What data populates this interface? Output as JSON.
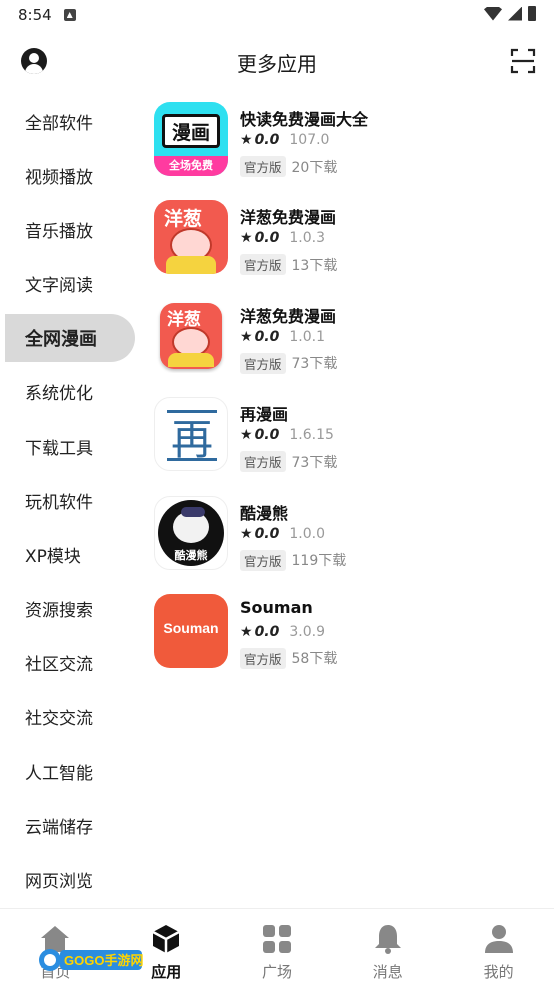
{
  "status_bar": {
    "time": "8:54"
  },
  "header": {
    "title": "更多应用"
  },
  "sidebar": {
    "items": [
      {
        "label": "全部软件",
        "active": false
      },
      {
        "label": "视频播放",
        "active": false
      },
      {
        "label": "音乐播放",
        "active": false
      },
      {
        "label": "文字阅读",
        "active": false
      },
      {
        "label": "全网漫画",
        "active": true
      },
      {
        "label": "系统优化",
        "active": false
      },
      {
        "label": "下载工具",
        "active": false
      },
      {
        "label": "玩机软件",
        "active": false
      },
      {
        "label": "XP模块",
        "active": false
      },
      {
        "label": "资源搜索",
        "active": false
      },
      {
        "label": "社区交流",
        "active": false
      },
      {
        "label": "社交交流",
        "active": false
      },
      {
        "label": "人工智能",
        "active": false
      },
      {
        "label": "云端储存",
        "active": false
      },
      {
        "label": "网页浏览",
        "active": false
      }
    ]
  },
  "apps": [
    {
      "name": "快读免费漫画大全",
      "rating": "0.0",
      "version": "107.0",
      "badge": "官方版",
      "downloads": "20下载",
      "icon": "kuaidu-comic-icon",
      "icon_text_top": "漫画",
      "icon_text_bottom": "全场免费"
    },
    {
      "name": "洋葱免费漫画",
      "rating": "0.0",
      "version": "1.0.3",
      "badge": "官方版",
      "downloads": "13下载",
      "icon": "onion-comic-icon",
      "icon_text_top": "洋葱"
    },
    {
      "name": "洋葱免费漫画",
      "rating": "0.0",
      "version": "1.0.1",
      "badge": "官方版",
      "downloads": "73下载",
      "icon": "onion-comic-icon",
      "icon_text_top": "洋葱"
    },
    {
      "name": "再漫画",
      "rating": "0.0",
      "version": "1.6.15",
      "badge": "官方版",
      "downloads": "73下载",
      "icon": "zai-comic-icon",
      "icon_text_top": "再"
    },
    {
      "name": "酷漫熊",
      "rating": "0.0",
      "version": "1.0.0",
      "badge": "官方版",
      "downloads": "119下载",
      "icon": "kuman-bear-icon",
      "icon_text_top": "酷漫熊"
    },
    {
      "name": "Souman",
      "rating": "0.0",
      "version": "3.0.9",
      "badge": "官方版",
      "downloads": "58下载",
      "icon": "souman-icon",
      "icon_text_top": "Souman"
    }
  ],
  "bottom_nav": [
    {
      "label": "首页",
      "icon": "home-icon",
      "active": false
    },
    {
      "label": "应用",
      "icon": "cube-icon",
      "active": true
    },
    {
      "label": "广场",
      "icon": "grid-icon",
      "active": false
    },
    {
      "label": "消息",
      "icon": "bell-icon",
      "active": false
    },
    {
      "label": "我的",
      "icon": "person-icon",
      "active": false
    }
  ],
  "watermark": {
    "brand": "GOGO手游网"
  },
  "colors": {
    "active_tab_bg": "#d9d9d9",
    "onion_red": "#f25a4f",
    "souman_orange": "#f05a3b",
    "kuaidu_cyan": "#2ee0f0"
  }
}
